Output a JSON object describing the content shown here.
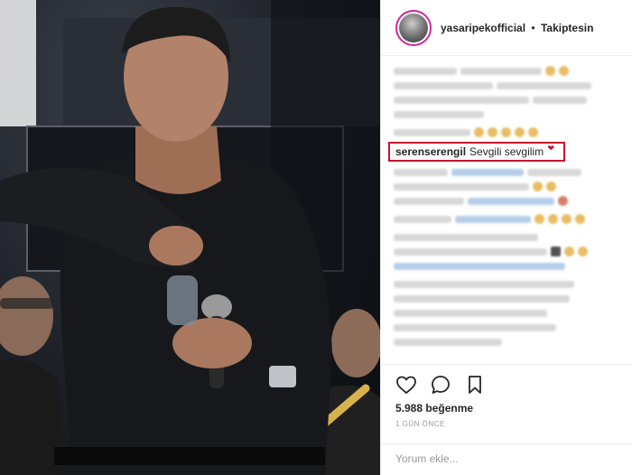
{
  "post": {
    "username": "yasaripekofficial",
    "separator": "•",
    "follow_status": "Takiptesin",
    "highlighted_comment": {
      "username": "serenserengil",
      "text": "Sevgili sevgilim"
    },
    "likes": "5.988 beğenme",
    "time_ago": "1 GÜN ÖNCE",
    "comment_placeholder": "Yorum ekle..."
  },
  "icons": {
    "like": "heart-icon",
    "comment": "comment-icon",
    "save": "bookmark-icon"
  },
  "colors": {
    "highlight_border": "#c8102e",
    "text": "#262626",
    "muted": "#999999",
    "divider": "#efefef"
  }
}
